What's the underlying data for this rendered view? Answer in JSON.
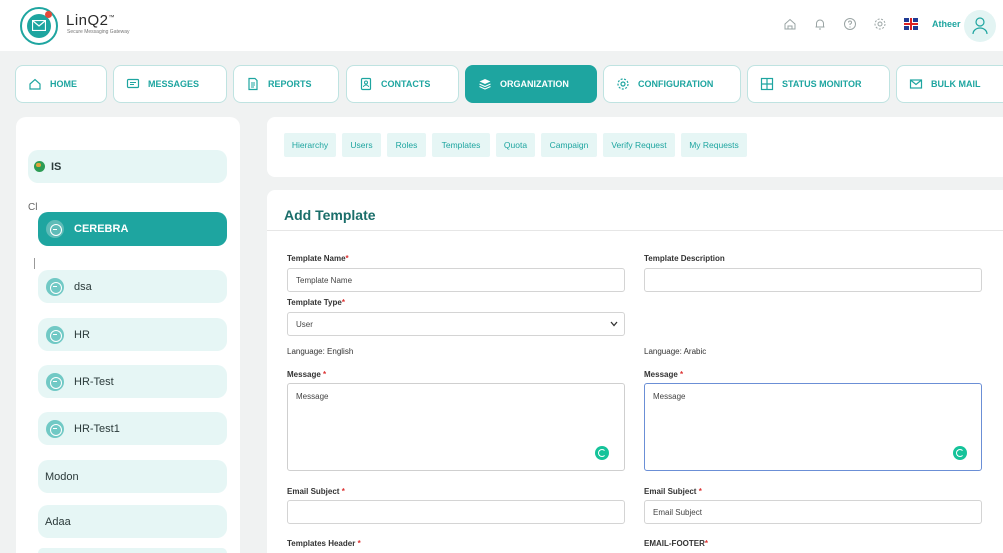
{
  "header": {
    "brand": "LinQ2",
    "brand_sup": "™",
    "tagline": "Secure Messaging Gateway",
    "username": "Atheer",
    "icons": [
      "home-outline-icon",
      "bell-icon",
      "help-icon",
      "gear-icon",
      "uk-flag-icon",
      "user-avatar-icon"
    ]
  },
  "nav": {
    "items": [
      {
        "label": "HOME",
        "icon": "home-icon"
      },
      {
        "label": "MESSAGES",
        "icon": "message-icon"
      },
      {
        "label": "REPORTS",
        "icon": "document-icon"
      },
      {
        "label": "CONTACTS",
        "icon": "contact-card-icon"
      },
      {
        "label": "ORGANIZATION",
        "icon": "layers-icon",
        "active": true
      },
      {
        "label": "CONFIGURATION",
        "icon": "gear-icon"
      },
      {
        "label": "STATUS MONITOR",
        "icon": "grid-icon"
      },
      {
        "label": "BULK MAIL",
        "icon": "mail-icon"
      }
    ]
  },
  "sidebar": {
    "root": "IS",
    "cl_label": "Cl",
    "items": [
      {
        "label": "CEREBRA",
        "selected": true
      },
      {
        "label": "dsa"
      },
      {
        "label": "HR"
      },
      {
        "label": "HR-Test"
      },
      {
        "label": "HR-Test1"
      },
      {
        "label": "Modon"
      },
      {
        "label": "Adaa"
      }
    ]
  },
  "subtabs": [
    "Hierarchy",
    "Users",
    "Roles",
    "Templates",
    "Quota",
    "Campaign",
    "Verify Request",
    "My Requests"
  ],
  "form": {
    "title": "Add Template",
    "template_name_label": "Template Name",
    "template_name_placeholder": "Template Name",
    "template_desc_label": "Template Description",
    "template_type_label": "Template Type",
    "template_type_value": "User",
    "lang_en_label": "Language: English",
    "lang_ar_label": "Language: Arabic",
    "message_label": "Message",
    "message_en_placeholder": "Message",
    "message_ar_value": "Message",
    "email_subject_label": "Email Subject",
    "email_subject_en_value": "",
    "email_subject_ar_placeholder": "Email Subject",
    "templates_header_label": "Templates Header",
    "email_footer_label": "EMAIL-FOOTER",
    "required_mark": "*"
  },
  "colors": {
    "accent": "#1ea5a0",
    "accent_light": "#e6f6f5",
    "focus_border": "#6b8fd6"
  }
}
